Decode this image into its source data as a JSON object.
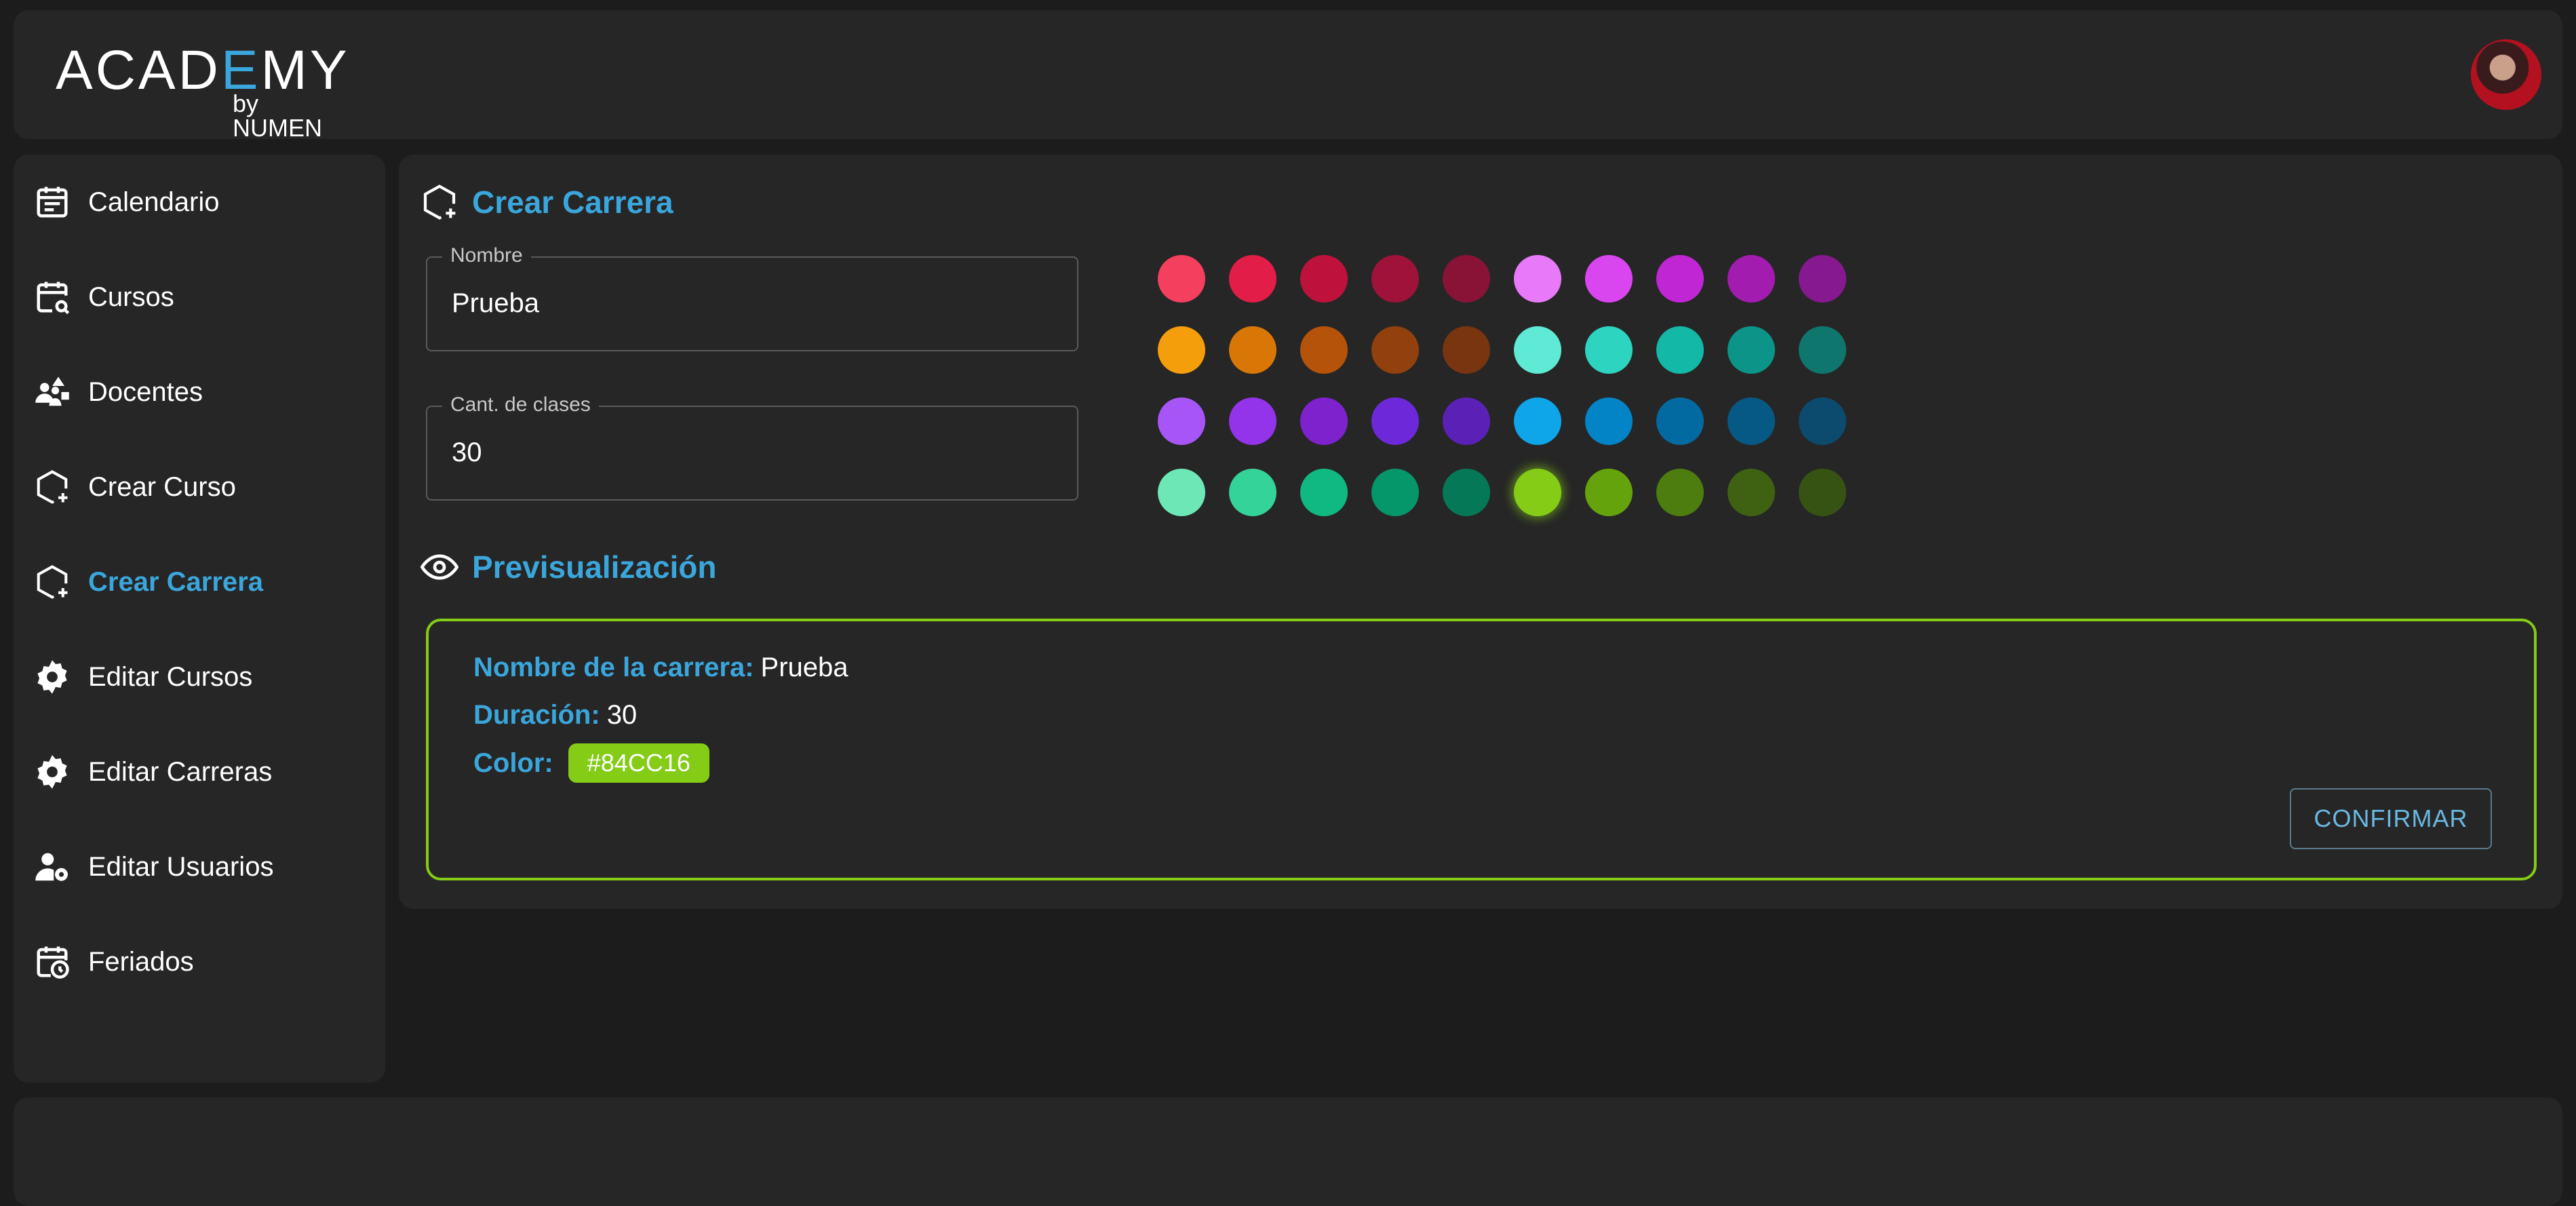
{
  "header": {
    "logo_word_a": "ACAD",
    "logo_word_b": "E",
    "logo_word_c": "MY",
    "logo_sub": "by NUMEN"
  },
  "sidebar": {
    "items": [
      {
        "label": "Calendario",
        "icon": "calendar-icon"
      },
      {
        "label": "Cursos",
        "icon": "calendar-search-icon"
      },
      {
        "label": "Docentes",
        "icon": "people-shapes-icon"
      },
      {
        "label": "Crear Curso",
        "icon": "hexagon-plus-icon"
      },
      {
        "label": "Crear Carrera",
        "icon": "hexagon-plus-icon",
        "active": true
      },
      {
        "label": "Editar Cursos",
        "icon": "gear-icon"
      },
      {
        "label": "Editar Carreras",
        "icon": "gear-icon"
      },
      {
        "label": "Editar Usuarios",
        "icon": "user-gear-icon"
      },
      {
        "label": "Feriados",
        "icon": "calendar-clock-icon"
      }
    ]
  },
  "form": {
    "title": "Crear Carrera",
    "nombre_label": "Nombre",
    "nombre_value": "Prueba",
    "clases_label": "Cant. de clases",
    "clases_value": "30"
  },
  "palette": {
    "colors": [
      [
        "#f43f5e",
        "#e11d48",
        "#be123c",
        "#9f1239",
        "#881337",
        "#e879f9",
        "#d946ef",
        "#c026d3",
        "#a21caf",
        "#86198f"
      ],
      [
        "#f59e0b",
        "#d97706",
        "#b45309",
        "#92400e",
        "#78350f",
        "#5eead4",
        "#2dd4bf",
        "#14b8a6",
        "#0d9488",
        "#0f766e"
      ],
      [
        "#a855f7",
        "#9333ea",
        "#7e22ce",
        "#6d28d9",
        "#5b21b6",
        "#0ea5e9",
        "#0284c7",
        "#0369a1",
        "#075985",
        "#0c4a6e"
      ],
      [
        "#6ee7b7",
        "#34d399",
        "#10b981",
        "#059669",
        "#047857",
        "#84cc16",
        "#65a30d",
        "#4d7c0f",
        "#3f6212",
        "#365314"
      ]
    ],
    "selected": "#84CC16"
  },
  "preview": {
    "title": "Previsualización",
    "nombre_key": "Nombre de la carrera:",
    "nombre_val": "Prueba",
    "duracion_key": "Duración:",
    "duracion_val": "30",
    "color_key": "Color:",
    "color_val": "#84CC16",
    "confirm_label": "CONFIRMAR"
  },
  "theme": {
    "accent": "#3aa6dc",
    "selected_color": "#84cc16"
  }
}
